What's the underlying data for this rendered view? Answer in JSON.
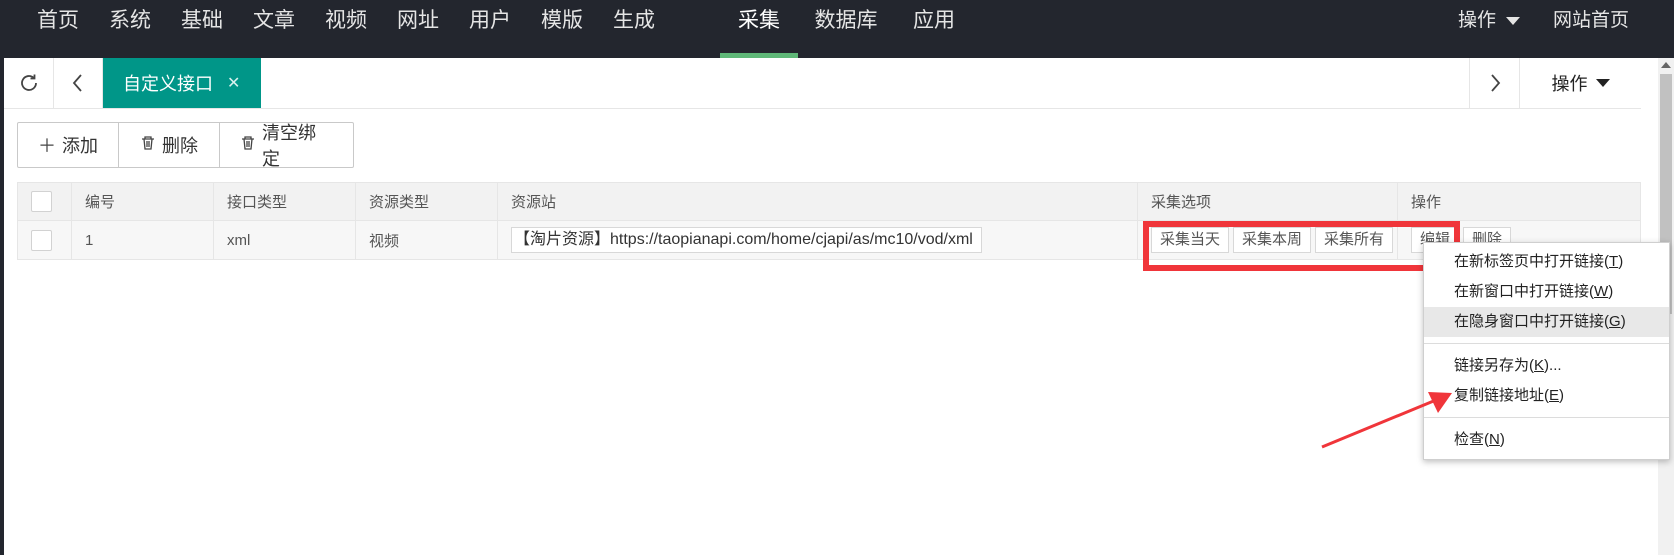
{
  "topnav": {
    "items": [
      "首页",
      "系统",
      "基础",
      "文章",
      "视频",
      "网址",
      "用户",
      "模版",
      "生成",
      "采集",
      "数据库",
      "应用"
    ],
    "active_index": 9,
    "ops_label": "操作",
    "home_label": "网站首页"
  },
  "tabbar": {
    "refresh_icon": "refresh-icon",
    "prev_icon": "chevron-left-icon",
    "active_tab": "自定义接口",
    "close_icon": "close-icon",
    "next_icon": "chevron-right-icon",
    "ops_label": "操作"
  },
  "toolbar": {
    "add_label": "添加",
    "delete_label": "删除",
    "clear_label": "清空绑定"
  },
  "table": {
    "headers": [
      "编号",
      "接口类型",
      "资源类型",
      "资源站",
      "采集选项",
      "操作"
    ],
    "rows": [
      {
        "id": "1",
        "api_type": "xml",
        "res_type": "视频",
        "source": "【淘片资源】https://taopianapi.com/home/cjapi/as/mc10/vod/xml",
        "options": [
          "采集当天",
          "采集本周",
          "采集所有"
        ],
        "actions": [
          "编辑",
          "删除"
        ]
      }
    ]
  },
  "context_menu": {
    "items": [
      {
        "label": "在新标签页中打开链接",
        "key": "T"
      },
      {
        "label": "在新窗口中打开链接",
        "key": "W"
      },
      {
        "label": "在隐身窗口中打开链接",
        "key": "G"
      },
      {
        "label": "链接另存为",
        "key": "K",
        "suffix": "..."
      },
      {
        "label": "复制链接地址",
        "key": "E"
      },
      {
        "label": "检查",
        "key": "N"
      }
    ]
  },
  "colors": {
    "nav_bg": "#23262e",
    "accent_green": "#5fb878",
    "tab_teal": "#009688",
    "highlight_red": "#f0353a"
  }
}
